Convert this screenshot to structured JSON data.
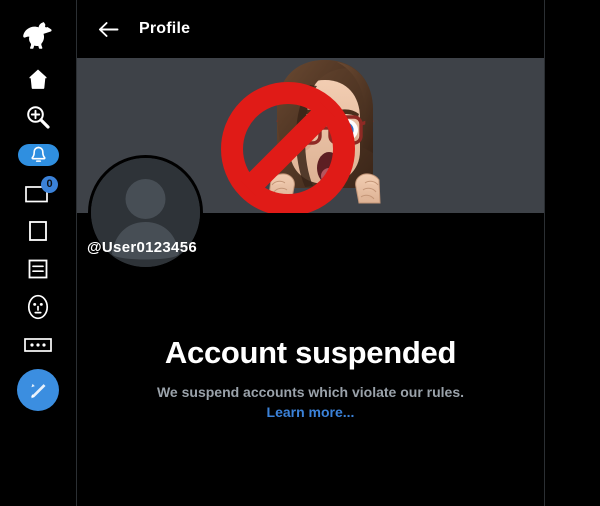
{
  "app": {
    "accent_color": "#3b8ee0",
    "banner_color": "#3e4248",
    "background_color": "#000000",
    "muted_text_color": "#9aa2aa",
    "link_color": "#3b82d9"
  },
  "sidebar": {
    "logo": {
      "icon": "duck-logo-icon"
    },
    "items": [
      {
        "icon": "home-icon",
        "name": "home",
        "active": false,
        "badge": null
      },
      {
        "icon": "search-plus-icon",
        "name": "explore",
        "active": false,
        "badge": null
      },
      {
        "icon": "bell-icon",
        "name": "notifications",
        "active": true,
        "badge": null
      },
      {
        "icon": "messages-icon",
        "name": "messages",
        "active": false,
        "badge": "0"
      },
      {
        "icon": "bookmark-icon",
        "name": "bookmarks",
        "active": false,
        "badge": null
      },
      {
        "icon": "lists-icon",
        "name": "lists",
        "active": false,
        "badge": null
      },
      {
        "icon": "profile-face-icon",
        "name": "profile",
        "active": false,
        "badge": null
      },
      {
        "icon": "more-dots-icon",
        "name": "more",
        "active": false,
        "badge": null
      }
    ],
    "compose": {
      "icon": "pencil-compose-icon",
      "name": "compose"
    }
  },
  "header": {
    "back_icon": "back-arrow-icon",
    "title": "Profile"
  },
  "profile": {
    "banner_image": "cartoon-character-with-no-entry-sign",
    "avatar_image": "default-person-silhouette",
    "handle": "@User0123456"
  },
  "suspension": {
    "title": "Account suspended",
    "description": "We suspend accounts which violate our rules.",
    "learn_more": "Learn more..."
  }
}
